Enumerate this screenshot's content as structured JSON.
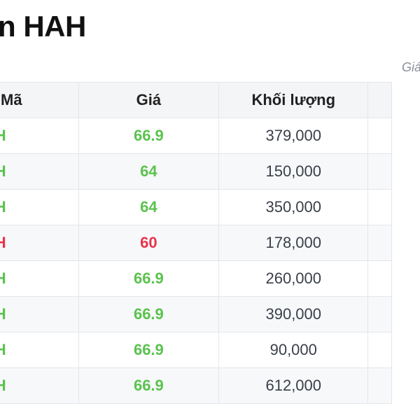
{
  "page": {
    "title": "n HAH",
    "note": "Giá"
  },
  "colors": {
    "up": "#5bc24e",
    "down": "#e8334a"
  },
  "table": {
    "headers": {
      "code": "Mã",
      "price": "Giá",
      "volume": "Khối lượng",
      "extra": ""
    },
    "rows": [
      {
        "code": "HAH",
        "price": "66.9",
        "volume": "379,000",
        "trend": "up"
      },
      {
        "code": "HAH",
        "price": "64",
        "volume": "150,000",
        "trend": "up"
      },
      {
        "code": "HAH",
        "price": "64",
        "volume": "350,000",
        "trend": "up"
      },
      {
        "code": "HAH",
        "price": "60",
        "volume": "178,000",
        "trend": "down"
      },
      {
        "code": "HAH",
        "price": "66.9",
        "volume": "260,000",
        "trend": "up"
      },
      {
        "code": "HAH",
        "price": "66.9",
        "volume": "390,000",
        "trend": "up"
      },
      {
        "code": "HAH",
        "price": "66.9",
        "volume": "90,000",
        "trend": "up"
      },
      {
        "code": "HAH",
        "price": "66.9",
        "volume": "612,000",
        "trend": "up"
      }
    ]
  }
}
